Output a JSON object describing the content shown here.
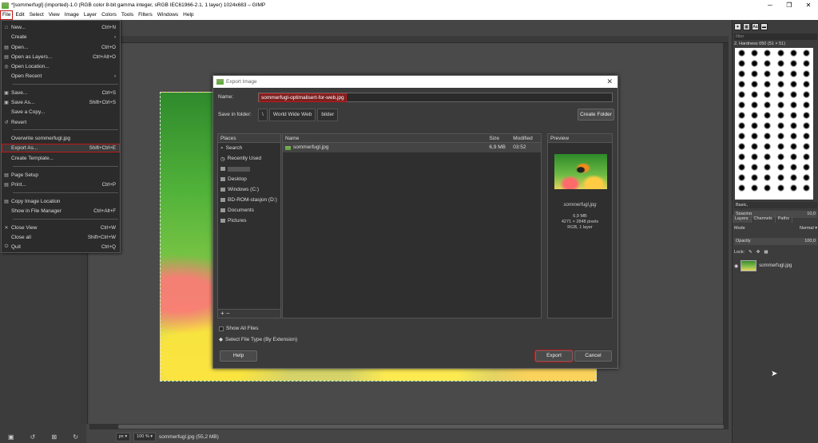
{
  "window": {
    "title": "*[sommerfugl] (imported)-1.0 (RGB color 8-bit gamma integer, sRGB IEC61966-2.1, 1 layer) 1024x683 – GIMP",
    "minimize": "─",
    "maximize": "❐",
    "close": "✕"
  },
  "menubar": [
    "File",
    "Edit",
    "Select",
    "View",
    "Image",
    "Layer",
    "Colors",
    "Tools",
    "Filters",
    "Windows",
    "Help"
  ],
  "file_menu": [
    {
      "label": "New...",
      "shortcut": "Ctrl+N",
      "icon": "□"
    },
    {
      "label": "Create",
      "shortcut": "›",
      "icon": ""
    },
    {
      "label": "Open...",
      "shortcut": "Ctrl+O",
      "icon": "▤"
    },
    {
      "label": "Open as Layers...",
      "shortcut": "Ctrl+Alt+O",
      "icon": "▤"
    },
    {
      "label": "Open Location...",
      "shortcut": "",
      "icon": "◎"
    },
    {
      "label": "Open Recent",
      "shortcut": "›",
      "icon": ""
    },
    {
      "label": "Save...",
      "shortcut": "Ctrl+S",
      "icon": "▣"
    },
    {
      "label": "Save As...",
      "shortcut": "Shift+Ctrl+S",
      "icon": "▣"
    },
    {
      "label": "Save a Copy...",
      "shortcut": "",
      "icon": ""
    },
    {
      "label": "Revert",
      "shortcut": "",
      "icon": "↺"
    },
    {
      "label": "Overwrite sommerfugl.jpg",
      "shortcut": "",
      "icon": ""
    },
    {
      "label": "Export As...",
      "shortcut": "Shift+Ctrl+E",
      "icon": ""
    },
    {
      "label": "Create Template...",
      "shortcut": "",
      "icon": ""
    },
    {
      "label": "Page Setup",
      "shortcut": "",
      "icon": "▤"
    },
    {
      "label": "Print...",
      "shortcut": "Ctrl+P",
      "icon": "▤"
    },
    {
      "label": "Copy Image Location",
      "shortcut": "",
      "icon": "▤"
    },
    {
      "label": "Show in File Manager",
      "shortcut": "Ctrl+Alt+F",
      "icon": ""
    },
    {
      "label": "Close View",
      "shortcut": "Ctrl+W",
      "icon": "✕"
    },
    {
      "label": "Close all",
      "shortcut": "Shift+Ctrl+W",
      "icon": ""
    },
    {
      "label": "Quit",
      "shortcut": "Ctrl+Q",
      "icon": "⏻"
    }
  ],
  "status": {
    "unit": "px ▾",
    "zoom": "100 % ▾",
    "file": "sommerfugl.jpg (55,2 MB)"
  },
  "dialog": {
    "title": "Export Image",
    "close": "✕",
    "name_label": "Name:",
    "name_value": "sommerfugl-optimalisert-for-web.jpg",
    "save_in_label": "Save in folder:",
    "path": [
      "\\",
      "World Wide Web",
      "bilder"
    ],
    "create_folder": "Create Folder",
    "places_header": "Places",
    "places": [
      "Search",
      "Recently Used",
      "",
      "Desktop",
      "Windows (C:)",
      "BD-ROM-stasjon (D:)",
      "Documents",
      "Pictures"
    ],
    "places_add_remove": "+ −",
    "columns": {
      "name": "Name",
      "size": "Size",
      "modified": "Modified"
    },
    "file_row": {
      "name": "sommerfugl.jpg",
      "size": "6,9 MB",
      "modified": "03:52"
    },
    "preview_header": "Preview",
    "preview_name": "sommerfugl.jpg",
    "preview_size": "6,9 MB",
    "preview_dims": "4271 × 2848 pixels",
    "preview_mode": "RGB, 1 layer",
    "show_all_files": "Show All Files",
    "select_type": "Select File Type (By Extension)",
    "help": "Help",
    "export": "Export",
    "cancel": "Cancel"
  },
  "dock": {
    "filter_placeholder": "filter",
    "brush_name": "2. Hardness 050 (51 × 51)",
    "preset": "Basic,",
    "spacing_label": "Spacing",
    "spacing_value": "10,0",
    "layers_tab": "Layers",
    "channels_tab": "Channels",
    "paths_tab": "Paths",
    "mode_label": "Mode",
    "mode_value": "Normal ▾",
    "opacity_label": "Opacity",
    "opacity_value": "100,0",
    "lock_label": "Lock:",
    "layer_name": "sommerfugl.jpg"
  }
}
